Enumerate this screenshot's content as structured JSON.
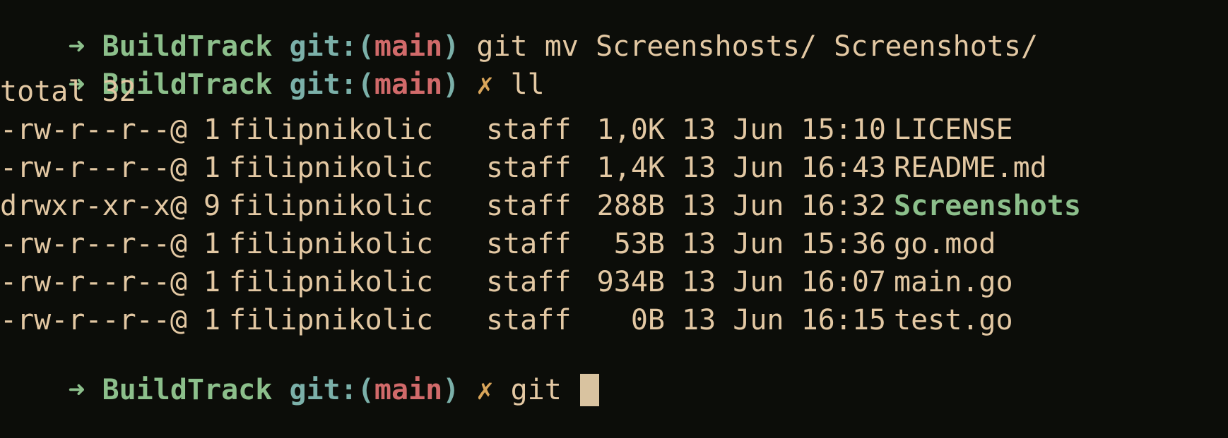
{
  "terminal": {
    "prompt": {
      "arrow": "➜",
      "directory": "BuildTrack",
      "git_label": "git:(",
      "branch": "main",
      "git_close": ")",
      "dirty_marker": "✗"
    },
    "commands": [
      {
        "dirty": false,
        "text": "git mv Screenshosts/ Screenshots/"
      },
      {
        "dirty": true,
        "text": "ll"
      }
    ],
    "total_line": "total 32",
    "listing": [
      {
        "perm": "-rw-r--r--@",
        "links": "1",
        "owner": "filipnikolic",
        "group": "staff",
        "size": "1,0K",
        "date": "13 Jun 15:10",
        "name": "LICENSE",
        "is_dir": false
      },
      {
        "perm": "-rw-r--r--@",
        "links": "1",
        "owner": "filipnikolic",
        "group": "staff",
        "size": "1,4K",
        "date": "13 Jun 16:43",
        "name": "README.md",
        "is_dir": false
      },
      {
        "perm": "drwxr-xr-x@",
        "links": "9",
        "owner": "filipnikolic",
        "group": "staff",
        "size": "288B",
        "date": "13 Jun 16:32",
        "name": "Screenshots",
        "is_dir": true
      },
      {
        "perm": "-rw-r--r--@",
        "links": "1",
        "owner": "filipnikolic",
        "group": "staff",
        "size": "53B",
        "date": "13 Jun 15:36",
        "name": "go.mod",
        "is_dir": false
      },
      {
        "perm": "-rw-r--r--@",
        "links": "1",
        "owner": "filipnikolic",
        "group": "staff",
        "size": "934B",
        "date": "13 Jun 16:07",
        "name": "main.go",
        "is_dir": false
      },
      {
        "perm": "-rw-r--r--@",
        "links": "1",
        "owner": "filipnikolic",
        "group": "staff",
        "size": "0B",
        "date": "13 Jun 16:15",
        "name": "test.go",
        "is_dir": false
      }
    ],
    "current_input": "git",
    "colors": {
      "background": "#0c0d09",
      "foreground": "#e3c8a3",
      "prompt_green": "#8cbf8b",
      "git_teal": "#7bb0a9",
      "branch_red": "#d16a6a",
      "dirty_orange": "#d9a55a",
      "cursor": "#d9c3a0"
    }
  }
}
